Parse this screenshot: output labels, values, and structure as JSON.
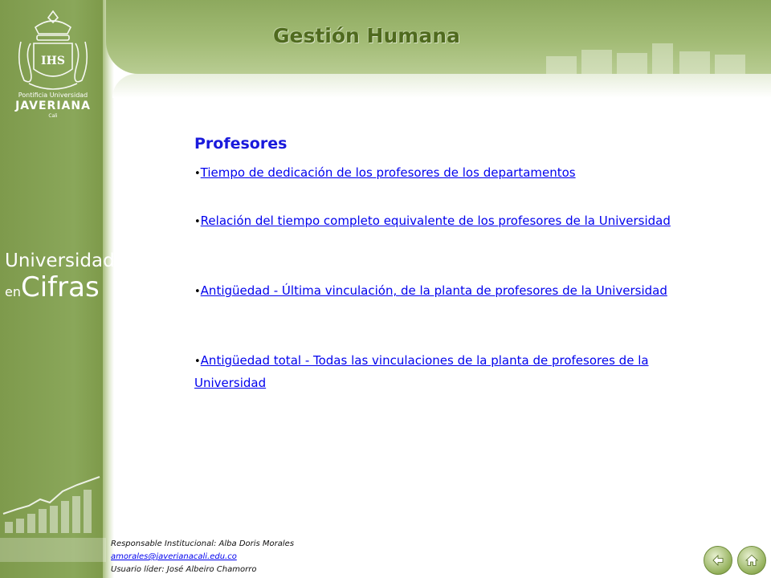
{
  "header": {
    "title": "Gestión Humana"
  },
  "sidebar": {
    "logo_initials": "IHS",
    "logo_line1": "Pontificia Universidad",
    "logo_line2": "JAVERIANA",
    "logo_line3": "Cali",
    "brand_line1": "Universidad",
    "brand_line2a": "en",
    "brand_line2b": "Cifras"
  },
  "main": {
    "section_title": "Profesores",
    "links": [
      {
        "label": "Tiempo de dedicación de los  profesores  de los departamentos"
      },
      {
        "label": "Relación del tiempo completo equivalente de los profesores  de la Universidad"
      },
      {
        "label": "Antigüedad -  Última vinculación,  de la planta de profesores  de la Universidad"
      },
      {
        "label": "Antigüedad total - Todas las vinculaciones de la planta de  profesores de la Universidad"
      }
    ]
  },
  "footer": {
    "responsible": "Responsable  Institucional: Alba Doris Morales",
    "email": "amorales@javerianacali.edu.co",
    "leader": "Usuario líder: José  Albeiro Chamorro"
  },
  "nav": {
    "back_icon": "back-arrow-icon",
    "home_icon": "home-icon"
  },
  "colors": {
    "sidebar": "#8aa75a",
    "title": "#4f6a1e",
    "section_title": "#1a1adc",
    "link": "#0000ee"
  }
}
